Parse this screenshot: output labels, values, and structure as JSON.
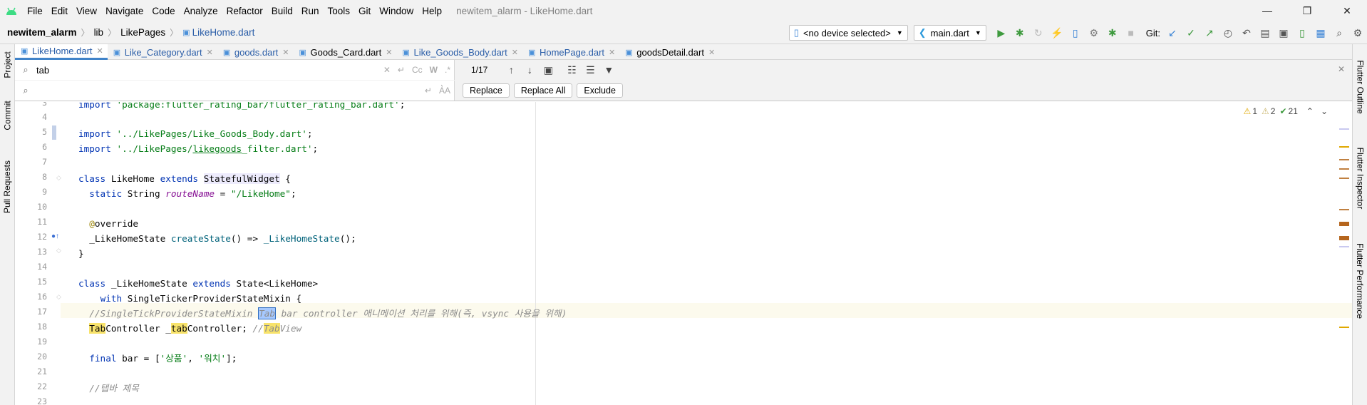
{
  "menubar": {
    "items": [
      "File",
      "Edit",
      "View",
      "Navigate",
      "Code",
      "Analyze",
      "Refactor",
      "Build",
      "Run",
      "Tools",
      "Git",
      "Window",
      "Help"
    ],
    "title": "newitem_alarm - LikeHome.dart"
  },
  "navbar": {
    "breadcrumb": [
      "newitem_alarm",
      "lib",
      "LikePages",
      "LikeHome.dart"
    ],
    "device": "<no device selected>",
    "run_config": "main.dart",
    "git_label": "Git:"
  },
  "left_strip": [
    "Project",
    "Commit",
    "Pull Requests"
  ],
  "right_strip": [
    "Flutter Outline",
    "Flutter Inspector",
    "Flutter Performance"
  ],
  "tabs": [
    {
      "label": "LikeHome.dart",
      "active": true
    },
    {
      "label": "Like_Category.dart"
    },
    {
      "label": "goods.dart"
    },
    {
      "label": "Goods_Card.dart"
    },
    {
      "label": "Like_Goods_Body.dart"
    },
    {
      "label": "HomePage.dart"
    },
    {
      "label": "goodsDetail.dart"
    }
  ],
  "search": {
    "query": "tab",
    "match_count": "1/17",
    "opt_case": "Cc",
    "opt_words": "W",
    "opt_regex": ".*",
    "regex_short": "A͛A",
    "replace_button": "Replace",
    "replace_all_button": "Replace All",
    "exclude_button": "Exclude"
  },
  "inspections": {
    "warnings": "1",
    "weak": "2",
    "typos": "21"
  },
  "editor": {
    "line_numbers": [
      "3",
      "4",
      "5",
      "6",
      "7",
      "8",
      "9",
      "10",
      "11",
      "12",
      "13",
      "14",
      "15",
      "16",
      "17",
      "18",
      "19",
      "20",
      "21",
      "22",
      "23"
    ]
  }
}
